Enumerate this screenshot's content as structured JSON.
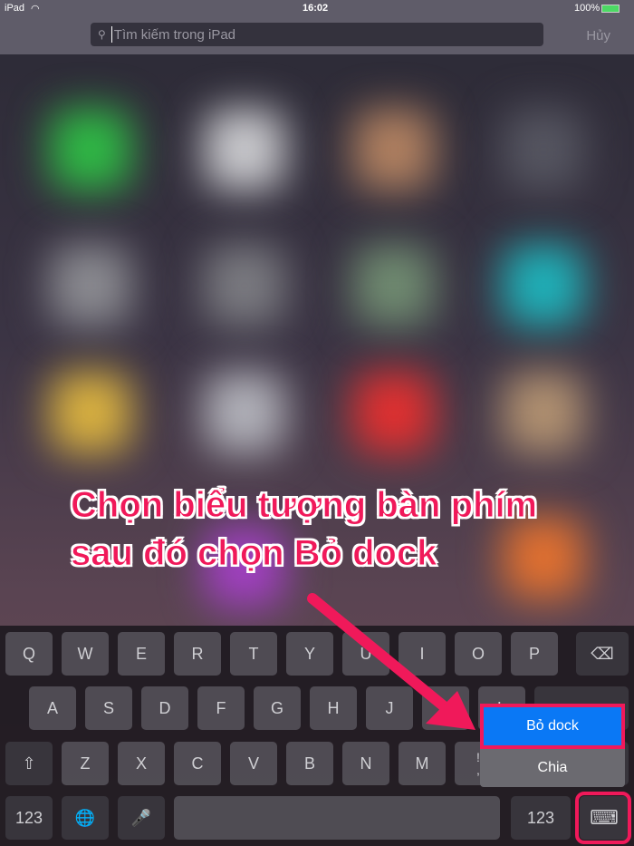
{
  "status": {
    "device": "iPad",
    "time": "16:02",
    "battery": "100%"
  },
  "search": {
    "placeholder": "Tìm kiếm trong iPad",
    "cancel": "Hủy"
  },
  "annotation": {
    "line1": "Chọn biểu tượng bàn phím",
    "line2": "sau đó chọn Bỏ dock",
    "color": "#f0195a"
  },
  "keyboard": {
    "row1": [
      "Q",
      "W",
      "E",
      "R",
      "T",
      "Y",
      "U",
      "I",
      "O",
      "P"
    ],
    "row2": [
      "A",
      "S",
      "D",
      "F",
      "G",
      "H",
      "J",
      "K",
      "L"
    ],
    "row3": [
      "Z",
      "X",
      "C",
      "V",
      "B",
      "N",
      "M",
      "!\n,"
    ],
    "num": "123",
    "num2": "123"
  },
  "popup": {
    "undock": "Bỏ dock",
    "split": "Chia",
    "accent": "#0a78f5"
  }
}
